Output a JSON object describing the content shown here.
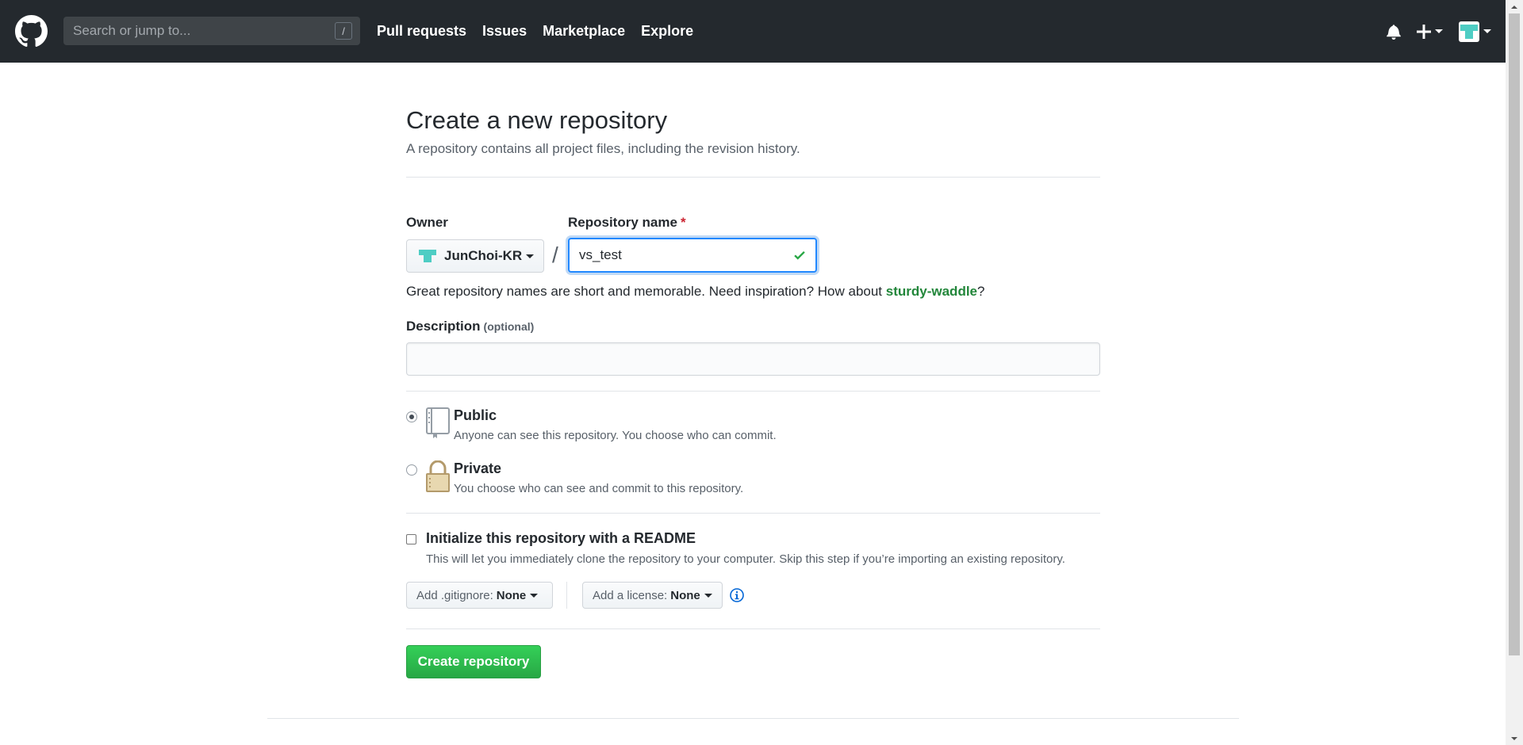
{
  "header": {
    "search_placeholder": "Search or jump to...",
    "search_key": "/",
    "nav": [
      "Pull requests",
      "Issues",
      "Marketplace",
      "Explore"
    ],
    "icons": [
      "github-logo-icon",
      "bell-icon",
      "plus-icon",
      "avatar"
    ]
  },
  "page": {
    "title": "Create a new repository",
    "subtitle": "A repository contains all project files, including the revision history."
  },
  "form": {
    "owner_label": "Owner",
    "owner_name": "JunChoi-KR",
    "separator": "/",
    "repo_label": "Repository name",
    "required_mark": "*",
    "repo_value": "vs_test",
    "hint_prefix": "Great repository names are short and memorable. Need inspiration? How about ",
    "hint_suggestion": "sturdy-waddle",
    "hint_suffix": "?",
    "description_label": "Description",
    "description_optional": "(optional)",
    "description_value": "",
    "visibility": [
      {
        "title": "Public",
        "desc": "Anyone can see this repository. You choose who can commit.",
        "checked": true
      },
      {
        "title": "Private",
        "desc": "You choose who can see and commit to this repository.",
        "checked": false
      }
    ],
    "readme_title": "Initialize this repository with a README",
    "readme_desc": "This will let you immediately clone the repository to your computer. Skip this step if you’re importing an existing repository.",
    "readme_checked": false,
    "gitignore_label": "Add .gitignore:",
    "gitignore_value": "None",
    "license_label": "Add a license:",
    "license_value": "None",
    "submit_label": "Create repository"
  },
  "colors": {
    "header_bg": "#24292e",
    "primary_green": "#28a745",
    "suggestion_green": "#22863a",
    "focus_blue": "#2188ff",
    "avatar_teal": "#4ecdc4"
  }
}
